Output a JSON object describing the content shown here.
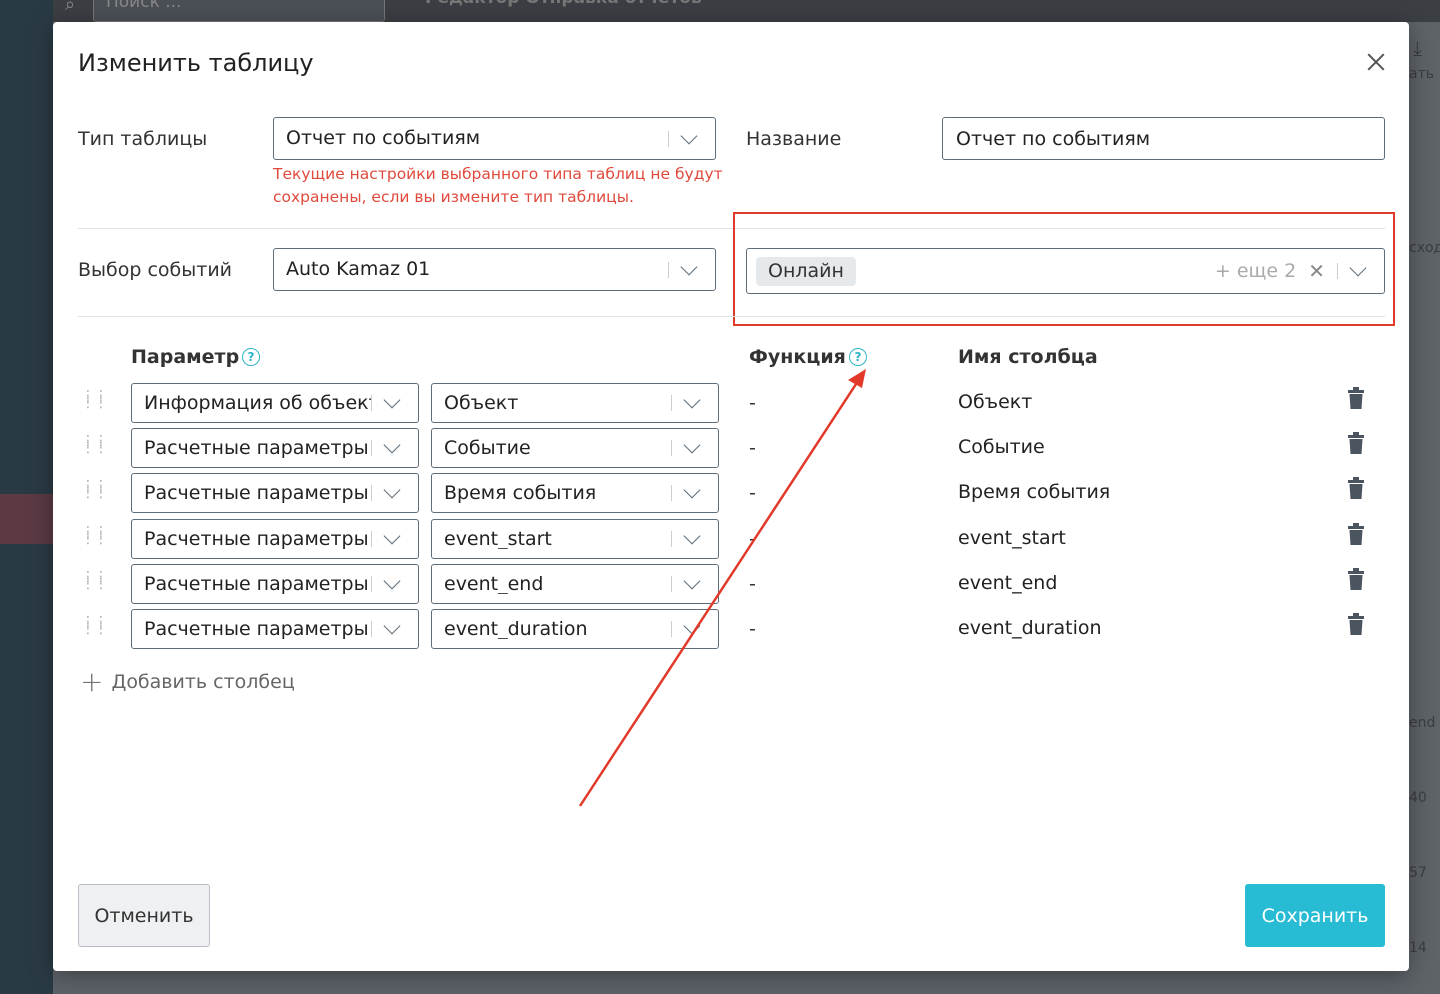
{
  "background": {
    "search_placeholder": "Поиск ...",
    "tabs_text": "Редактор    Отправка отчетов",
    "side_texts": [
      "сход",
      "end",
      "40",
      "57",
      "14"
    ],
    "download_label": "ать"
  },
  "modal": {
    "title": "Изменить таблицу",
    "table_type": {
      "label": "Тип таблицы",
      "value": "Отчет по событиям",
      "warning": "Текущие настройки выбранного типа таблиц не будут сохранены, если вы измените тип таблицы."
    },
    "name": {
      "label": "Название",
      "value": "Отчет по событиям"
    },
    "events": {
      "label": "Выбор событий",
      "value": "Auto Kamaz 01",
      "selected_tag": "Онлайн",
      "more_text": "+ еще 2"
    },
    "columns_header": {
      "parameter": "Параметр",
      "function": "Функция",
      "column_name": "Имя столбца"
    },
    "rows": [
      {
        "param": "Информация об объекте",
        "sub": "Объект",
        "func": "-",
        "name": "Объект"
      },
      {
        "param": "Расчетные параметры",
        "sub": "Событие",
        "func": "-",
        "name": "Событие"
      },
      {
        "param": "Расчетные параметры",
        "sub": "Время события",
        "func": "-",
        "name": "Время события"
      },
      {
        "param": "Расчетные параметры",
        "sub": "event_start",
        "func": "-",
        "name": "event_start"
      },
      {
        "param": "Расчетные параметры",
        "sub": "event_end",
        "func": "-",
        "name": "event_end"
      },
      {
        "param": "Расчетные параметры",
        "sub": "event_duration",
        "func": "-",
        "name": "event_duration"
      }
    ],
    "add_column": "Добавить столбец",
    "cancel": "Отменить",
    "save": "Сохранить"
  },
  "colors": {
    "accent": "#27bcd4",
    "warning": "#e04a3c",
    "annotation": "#e23a2a"
  }
}
